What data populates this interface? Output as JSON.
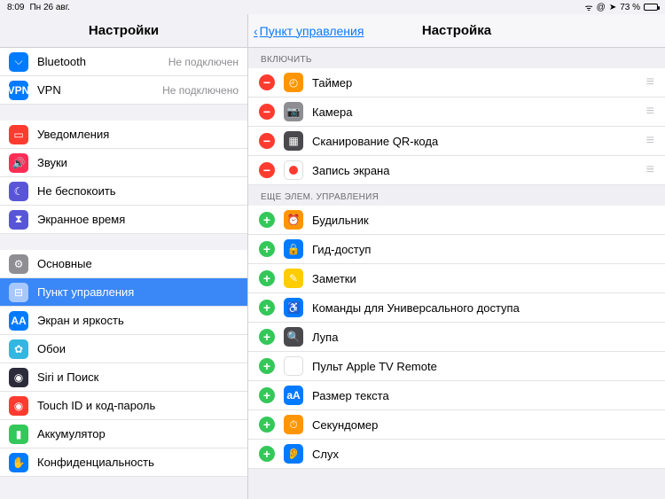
{
  "status": {
    "time": "8:09",
    "date": "Пн 26 авг.",
    "battery_pct": "73 %"
  },
  "sidebar": {
    "title": "Настройки",
    "groups": [
      {
        "items": [
          {
            "id": "bluetooth",
            "label": "Bluetooth",
            "sub": "Не подключен",
            "iconClass": "ic-bluetooth",
            "glyph": "⌵"
          },
          {
            "id": "vpn",
            "label": "VPN",
            "sub": "Не подключено",
            "iconClass": "ic-vpn",
            "glyph": "VPN"
          }
        ]
      },
      {
        "items": [
          {
            "id": "notifications",
            "label": "Уведомления",
            "iconClass": "ic-notify",
            "glyph": "▭"
          },
          {
            "id": "sounds",
            "label": "Звуки",
            "iconClass": "ic-sound",
            "glyph": "🔊"
          },
          {
            "id": "dnd",
            "label": "Не беспокоить",
            "iconClass": "ic-dnd",
            "glyph": "☾"
          },
          {
            "id": "screentime",
            "label": "Экранное время",
            "iconClass": "ic-screentime",
            "glyph": "⧗"
          }
        ]
      },
      {
        "items": [
          {
            "id": "general",
            "label": "Основные",
            "iconClass": "ic-general",
            "glyph": "⚙"
          },
          {
            "id": "control-center",
            "label": "Пункт управления",
            "iconClass": "ic-control",
            "glyph": "⊟",
            "selected": true
          },
          {
            "id": "display",
            "label": "Экран и яркость",
            "iconClass": "ic-display",
            "glyph": "AA"
          },
          {
            "id": "wallpaper",
            "label": "Обои",
            "iconClass": "ic-wall",
            "glyph": "✿"
          },
          {
            "id": "siri",
            "label": "Siri и Поиск",
            "iconClass": "ic-siri",
            "glyph": "◉"
          },
          {
            "id": "touchid",
            "label": "Touch ID и код-пароль",
            "iconClass": "ic-touch",
            "glyph": "◉"
          },
          {
            "id": "battery",
            "label": "Аккумулятор",
            "iconClass": "ic-batt",
            "glyph": "▮"
          },
          {
            "id": "privacy",
            "label": "Конфиденциальность",
            "iconClass": "ic-priv",
            "glyph": "✋"
          }
        ]
      }
    ]
  },
  "detail": {
    "back": "Пункт управления",
    "title": "Настройка",
    "sections": [
      {
        "header": "Включить",
        "mode": "remove",
        "items": [
          {
            "id": "timer",
            "label": "Таймер",
            "iconClass": "ic-timer",
            "glyph": "◴"
          },
          {
            "id": "camera",
            "label": "Камера",
            "iconClass": "ic-camera",
            "glyph": "📷"
          },
          {
            "id": "qr",
            "label": "Сканирование QR-кода",
            "iconClass": "ic-qr",
            "glyph": "▦"
          },
          {
            "id": "record",
            "label": "Запись экрана",
            "iconClass": "ic-rec",
            "glyph": ""
          }
        ]
      },
      {
        "header": "Еще элем. управления",
        "mode": "add",
        "items": [
          {
            "id": "alarm",
            "label": "Будильник",
            "iconClass": "ic-alarm",
            "glyph": "⏰"
          },
          {
            "id": "guided",
            "label": "Гид-доступ",
            "iconClass": "ic-guide",
            "glyph": "🔒"
          },
          {
            "id": "notes",
            "label": "Заметки",
            "iconClass": "ic-notes",
            "glyph": "✎"
          },
          {
            "id": "accessibility",
            "label": "Команды для Универсального доступа",
            "iconClass": "ic-access",
            "glyph": "♿"
          },
          {
            "id": "magnifier",
            "label": "Лупа",
            "iconClass": "ic-loupe",
            "glyph": "🔍"
          },
          {
            "id": "remote",
            "label": "Пульт Apple TV Remote",
            "iconClass": "ic-remote",
            "glyph": "▮"
          },
          {
            "id": "textsize",
            "label": "Размер текста",
            "iconClass": "ic-text",
            "glyph": "aA"
          },
          {
            "id": "stopwatch",
            "label": "Секундомер",
            "iconClass": "ic-stopw",
            "glyph": "⏱"
          },
          {
            "id": "hearing",
            "label": "Слух",
            "iconClass": "ic-hear",
            "glyph": "👂"
          }
        ]
      }
    ]
  }
}
